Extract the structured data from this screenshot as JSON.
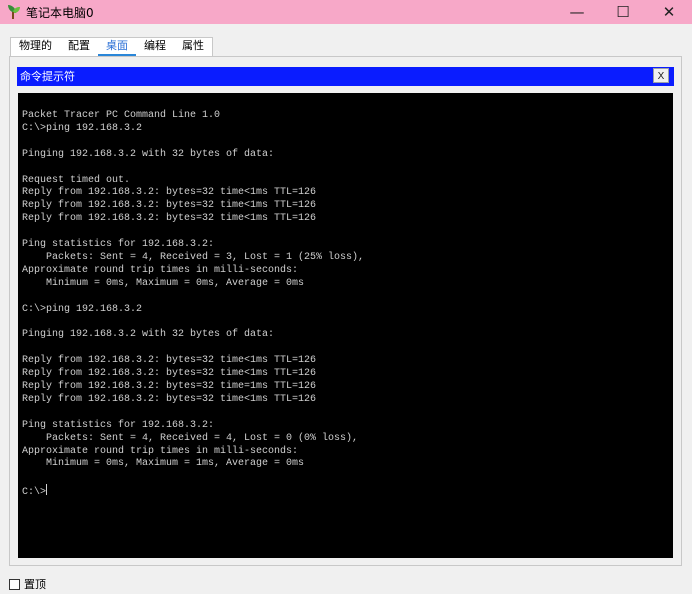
{
  "window": {
    "title": "笔记本电脑0",
    "minimize": "—",
    "maximize": "☐",
    "close": "✕"
  },
  "tabs": [
    {
      "label": "物理的"
    },
    {
      "label": "配置"
    },
    {
      "label": "桌面",
      "active": true
    },
    {
      "label": "编程"
    },
    {
      "label": "属性"
    }
  ],
  "command_prompt": {
    "title": "命令提示符",
    "close_label": "X",
    "lines": [
      "Packet Tracer PC Command Line 1.0",
      "C:\\>ping 192.168.3.2",
      "",
      "Pinging 192.168.3.2 with 32 bytes of data:",
      "",
      "Request timed out.",
      "Reply from 192.168.3.2: bytes=32 time<1ms TTL=126",
      "Reply from 192.168.3.2: bytes=32 time<1ms TTL=126",
      "Reply from 192.168.3.2: bytes=32 time<1ms TTL=126",
      "",
      "Ping statistics for 192.168.3.2:",
      "    Packets: Sent = 4, Received = 3, Lost = 1 (25% loss),",
      "Approximate round trip times in milli-seconds:",
      "    Minimum = 0ms, Maximum = 0ms, Average = 0ms",
      "",
      "C:\\>ping 192.168.3.2",
      "",
      "Pinging 192.168.3.2 with 32 bytes of data:",
      "",
      "Reply from 192.168.3.2: bytes=32 time<1ms TTL=126",
      "Reply from 192.168.3.2: bytes=32 time<1ms TTL=126",
      "Reply from 192.168.3.2: bytes=32 time=1ms TTL=126",
      "Reply from 192.168.3.2: bytes=32 time<1ms TTL=126",
      "",
      "Ping statistics for 192.168.3.2:",
      "    Packets: Sent = 4, Received = 4, Lost = 0 (0% loss),",
      "Approximate round trip times in milli-seconds:",
      "    Minimum = 0ms, Maximum = 1ms, Average = 0ms",
      ""
    ],
    "prompt": "C:\\>"
  },
  "footer": {
    "always_on_top_label": "置顶",
    "always_on_top_checked": false
  }
}
